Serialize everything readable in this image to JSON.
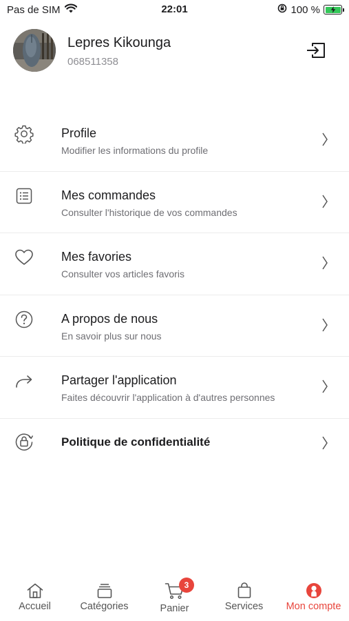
{
  "status_bar": {
    "carrier": "Pas de SIM",
    "time": "22:01",
    "battery_percent": "100 %",
    "icons": [
      "wifi-icon",
      "orientation-lock-icon",
      "battery-charging-icon"
    ]
  },
  "profile": {
    "name": "Lepres Kikounga",
    "phone": "068511358"
  },
  "menu": {
    "items": [
      {
        "title": "Profile",
        "subtitle": "Modifier les informations du profile",
        "icon": "gear-icon"
      },
      {
        "title": "Mes commandes",
        "subtitle": "Consulter l'historique de vos commandes",
        "icon": "list-icon"
      },
      {
        "title": "Mes favories",
        "subtitle": "Consulter vos articles favoris",
        "icon": "heart-icon"
      },
      {
        "title": "A propos de nous",
        "subtitle": "En savoir plus sur nous",
        "icon": "question-icon"
      },
      {
        "title": "Partager l'application",
        "subtitle": "Faites découvrir l'application à d'autres personnes",
        "icon": "share-icon"
      },
      {
        "title": "Politique de confidentialité",
        "subtitle": "",
        "icon": "privacy-lock-icon"
      }
    ]
  },
  "tabbar": {
    "tabs": [
      {
        "label": "Accueil",
        "icon": "home-icon"
      },
      {
        "label": "Catégories",
        "icon": "categories-icon"
      },
      {
        "label": "Panier",
        "icon": "cart-icon",
        "badge": "3"
      },
      {
        "label": "Services",
        "icon": "bag-icon"
      },
      {
        "label": "Mon compte",
        "icon": "account-icon",
        "active": true
      }
    ]
  },
  "colors": {
    "accent": "#e8453c",
    "text": "#1c1c1e",
    "muted": "#6e6e73",
    "icon": "#555555",
    "battery": "#34c759"
  }
}
